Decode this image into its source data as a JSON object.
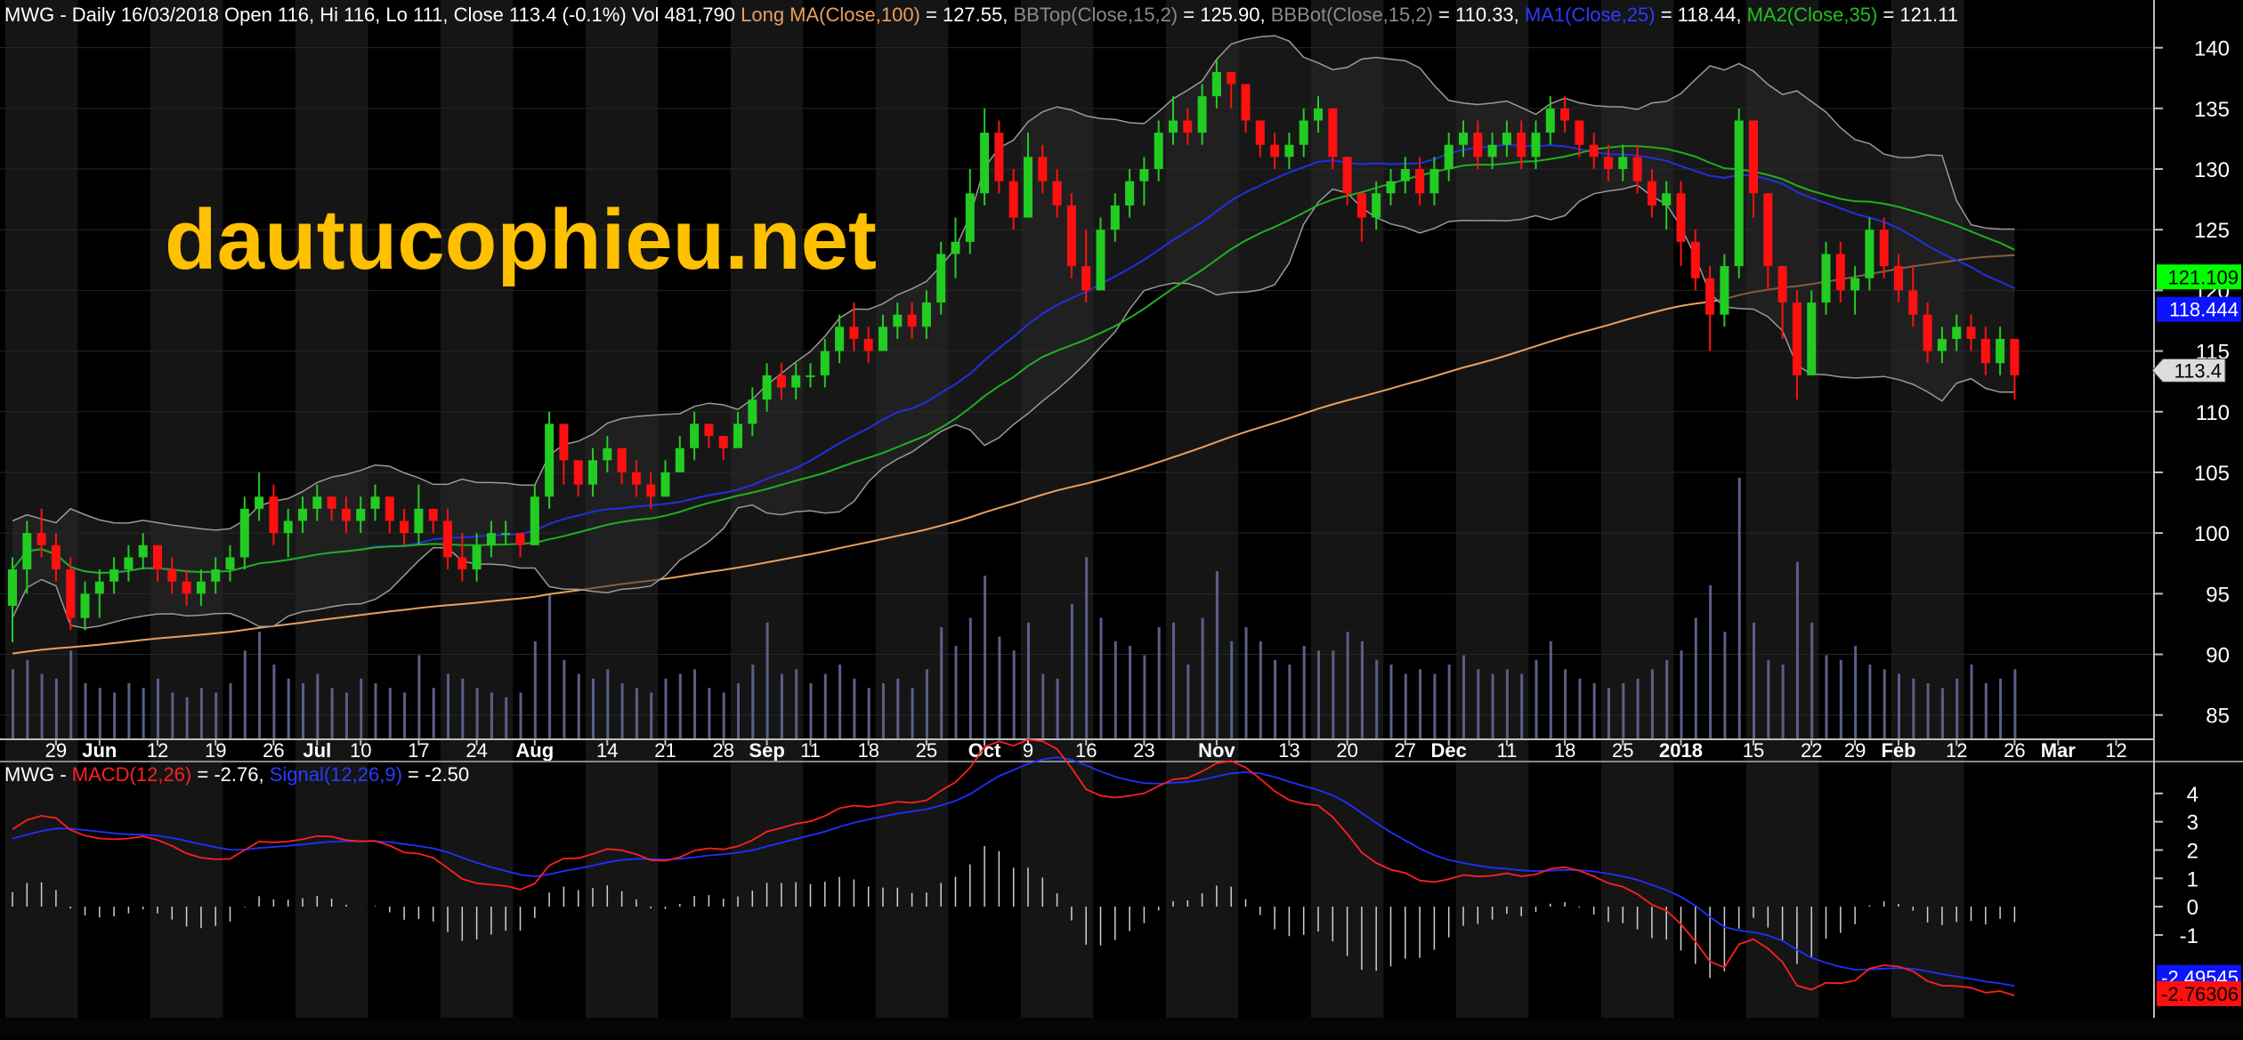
{
  "header": {
    "main_prefix": "MWG - Daily 16/03/2018 Open 116, Hi 116, Lo 111, Close 113.4 (-0.1%) Vol 481,790 ",
    "long_ma_label": "Long MA(Close,100)",
    "long_ma_value": " = 127.55, ",
    "bbtop_label": "BBTop(Close,15,2)",
    "bbtop_value": " = 125.90, ",
    "bbbot_label": "BBBot(Close,15,2)",
    "bbbot_value": " = 110.33, ",
    "ma1_label": "MA1(Close,25)",
    "ma1_value": " = 118.44, ",
    "ma2_label": "MA2(Close,35)",
    "ma2_value": " = 121.11",
    "macd_prefix": "MWG - ",
    "macd_label": "MACD(12,26)",
    "macd_value": " = -2.76, ",
    "signal_label": "Signal(12,26,9)",
    "signal_value": " = -2.50"
  },
  "watermark": "dautucophieu.net",
  "colors": {
    "up": "#22cc22",
    "down": "#ff1010",
    "ma100": "#e8a060",
    "bb": "#9a9a9a",
    "ma1": "#2030e0",
    "ma2": "#20b020",
    "macd": "#ff2020",
    "signal": "#2030ff",
    "watermark": "#ffc000"
  },
  "chart_data": [
    {
      "type": "candlestick",
      "name": "price",
      "ylim": [
        83,
        141
      ],
      "yticks": [
        85,
        90,
        95,
        100,
        105,
        110,
        115,
        120,
        125,
        130,
        135,
        140
      ],
      "xlabels": [
        {
          "i": 3,
          "t": "29"
        },
        {
          "i": 6,
          "t": "Jun"
        },
        {
          "i": 10,
          "t": "12"
        },
        {
          "i": 14,
          "t": "19"
        },
        {
          "i": 18,
          "t": "26"
        },
        {
          "i": 21,
          "t": "Jul"
        },
        {
          "i": 24,
          "t": "10"
        },
        {
          "i": 28,
          "t": "17"
        },
        {
          "i": 32,
          "t": "24"
        },
        {
          "i": 36,
          "t": "Aug"
        },
        {
          "i": 41,
          "t": "14"
        },
        {
          "i": 45,
          "t": "21"
        },
        {
          "i": 49,
          "t": "28"
        },
        {
          "i": 52,
          "t": "Sep"
        },
        {
          "i": 55,
          "t": "11"
        },
        {
          "i": 59,
          "t": "18"
        },
        {
          "i": 63,
          "t": "25"
        },
        {
          "i": 67,
          "t": "Oct"
        },
        {
          "i": 70,
          "t": "9"
        },
        {
          "i": 74,
          "t": "16"
        },
        {
          "i": 78,
          "t": "23"
        },
        {
          "i": 83,
          "t": "Nov"
        },
        {
          "i": 88,
          "t": "13"
        },
        {
          "i": 92,
          "t": "20"
        },
        {
          "i": 96,
          "t": "27"
        },
        {
          "i": 99,
          "t": "Dec"
        },
        {
          "i": 103,
          "t": "11"
        },
        {
          "i": 107,
          "t": "18"
        },
        {
          "i": 111,
          "t": "25"
        },
        {
          "i": 115,
          "t": "2018"
        },
        {
          "i": 120,
          "t": "15"
        },
        {
          "i": 124,
          "t": "22"
        },
        {
          "i": 127,
          "t": "29"
        },
        {
          "i": 130,
          "t": "Feb"
        },
        {
          "i": 134,
          "t": "12"
        },
        {
          "i": 138,
          "t": "26"
        },
        {
          "i": 141,
          "t": "Mar"
        },
        {
          "i": 145,
          "t": "12"
        }
      ],
      "ohlc": [
        [
          94,
          98,
          91,
          97
        ],
        [
          97,
          101,
          95,
          100
        ],
        [
          100,
          102,
          98,
          99
        ],
        [
          99,
          100,
          96,
          97
        ],
        [
          97,
          98,
          92,
          93
        ],
        [
          93,
          96,
          92,
          95
        ],
        [
          95,
          97,
          93,
          96
        ],
        [
          96,
          98,
          95,
          97
        ],
        [
          97,
          99,
          96,
          98
        ],
        [
          98,
          100,
          97,
          99
        ],
        [
          99,
          99,
          96,
          97
        ],
        [
          97,
          98,
          95,
          96
        ],
        [
          96,
          97,
          94,
          95
        ],
        [
          95,
          97,
          94,
          96
        ],
        [
          96,
          98,
          95,
          97
        ],
        [
          97,
          99,
          96,
          98
        ],
        [
          98,
          103,
          97,
          102
        ],
        [
          102,
          105,
          101,
          103
        ],
        [
          103,
          104,
          99,
          100
        ],
        [
          100,
          102,
          98,
          101
        ],
        [
          101,
          103,
          100,
          102
        ],
        [
          102,
          104,
          101,
          103
        ],
        [
          103,
          103,
          101,
          102
        ],
        [
          102,
          103,
          100,
          101
        ],
        [
          101,
          103,
          100,
          102
        ],
        [
          102,
          104,
          101,
          103
        ],
        [
          103,
          103,
          100,
          101
        ],
        [
          101,
          102,
          99,
          100
        ],
        [
          100,
          104,
          99,
          102
        ],
        [
          102,
          102,
          100,
          101
        ],
        [
          101,
          102,
          97,
          98
        ],
        [
          98,
          100,
          96,
          97
        ],
        [
          97,
          100,
          96,
          99
        ],
        [
          99,
          101,
          98,
          100
        ],
        [
          100,
          101,
          99,
          100
        ],
        [
          100,
          100,
          98,
          99
        ],
        [
          99,
          104,
          99,
          103
        ],
        [
          103,
          110,
          102,
          109
        ],
        [
          109,
          109,
          104,
          106
        ],
        [
          106,
          106,
          103,
          104
        ],
        [
          104,
          107,
          103,
          106
        ],
        [
          106,
          108,
          105,
          107
        ],
        [
          107,
          107,
          104,
          105
        ],
        [
          105,
          106,
          103,
          104
        ],
        [
          104,
          105,
          102,
          103
        ],
        [
          103,
          106,
          103,
          105
        ],
        [
          105,
          108,
          105,
          107
        ],
        [
          107,
          110,
          106,
          109
        ],
        [
          109,
          109,
          107,
          108
        ],
        [
          108,
          108,
          106,
          107
        ],
        [
          107,
          110,
          107,
          109
        ],
        [
          109,
          112,
          108,
          111
        ],
        [
          111,
          114,
          110,
          113
        ],
        [
          113,
          114,
          111,
          112
        ],
        [
          112,
          114,
          111,
          113
        ],
        [
          113,
          114,
          112,
          113
        ],
        [
          113,
          116,
          112,
          115
        ],
        [
          115,
          118,
          114,
          117
        ],
        [
          117,
          119,
          115,
          116
        ],
        [
          116,
          117,
          114,
          115
        ],
        [
          115,
          118,
          115,
          117
        ],
        [
          117,
          119,
          116,
          118
        ],
        [
          118,
          119,
          116,
          117
        ],
        [
          117,
          120,
          116,
          119
        ],
        [
          119,
          124,
          118,
          123
        ],
        [
          123,
          126,
          121,
          124
        ],
        [
          124,
          130,
          123,
          128
        ],
        [
          128,
          135,
          127,
          133
        ],
        [
          133,
          134,
          128,
          129
        ],
        [
          129,
          130,
          125,
          126
        ],
        [
          126,
          133,
          126,
          131
        ],
        [
          131,
          132,
          128,
          129
        ],
        [
          129,
          130,
          126,
          127
        ],
        [
          127,
          128,
          121,
          122
        ],
        [
          122,
          125,
          119,
          120
        ],
        [
          120,
          126,
          120,
          125
        ],
        [
          125,
          128,
          124,
          127
        ],
        [
          127,
          130,
          126,
          129
        ],
        [
          129,
          131,
          127,
          130
        ],
        [
          130,
          134,
          129,
          133
        ],
        [
          133,
          136,
          132,
          134
        ],
        [
          134,
          135,
          132,
          133
        ],
        [
          133,
          137,
          132,
          136
        ],
        [
          136,
          139,
          135,
          138
        ],
        [
          138,
          138,
          135,
          137
        ],
        [
          137,
          137,
          133,
          134
        ],
        [
          134,
          134,
          131,
          132
        ],
        [
          132,
          133,
          130,
          131
        ],
        [
          131,
          133,
          130,
          132
        ],
        [
          132,
          135,
          131,
          134
        ],
        [
          134,
          136,
          133,
          135
        ],
        [
          135,
          135,
          130,
          131
        ],
        [
          131,
          131,
          127,
          128
        ],
        [
          128,
          128,
          124,
          126
        ],
        [
          126,
          129,
          125,
          128
        ],
        [
          128,
          130,
          127,
          129
        ],
        [
          129,
          131,
          128,
          130
        ],
        [
          130,
          131,
          127,
          128
        ],
        [
          128,
          131,
          127,
          130
        ],
        [
          130,
          133,
          129,
          132
        ],
        [
          132,
          134,
          131,
          133
        ],
        [
          133,
          134,
          130,
          131
        ],
        [
          131,
          133,
          130,
          132
        ],
        [
          132,
          134,
          131,
          133
        ],
        [
          133,
          134,
          130,
          131
        ],
        [
          131,
          134,
          130,
          133
        ],
        [
          133,
          136,
          132,
          135
        ],
        [
          135,
          136,
          133,
          134
        ],
        [
          134,
          134,
          131,
          132
        ],
        [
          132,
          133,
          130,
          131
        ],
        [
          131,
          132,
          129,
          130
        ],
        [
          130,
          132,
          129,
          131
        ],
        [
          131,
          132,
          128,
          129
        ],
        [
          129,
          130,
          126,
          127
        ],
        [
          127,
          129,
          125,
          128
        ],
        [
          128,
          129,
          122,
          124
        ],
        [
          124,
          125,
          120,
          121
        ],
        [
          121,
          122,
          115,
          118
        ],
        [
          118,
          123,
          117,
          122
        ],
        [
          122,
          135,
          121,
          134
        ],
        [
          134,
          134,
          126,
          128
        ],
        [
          128,
          128,
          120,
          122
        ],
        [
          122,
          122,
          116,
          119
        ],
        [
          119,
          120,
          111,
          113
        ],
        [
          113,
          120,
          113,
          119
        ],
        [
          119,
          124,
          118,
          123
        ],
        [
          123,
          124,
          119,
          120
        ],
        [
          120,
          122,
          118,
          121
        ],
        [
          121,
          126,
          120,
          125
        ],
        [
          125,
          126,
          121,
          122
        ],
        [
          122,
          123,
          119,
          120
        ],
        [
          120,
          122,
          117,
          118
        ],
        [
          118,
          119,
          114,
          115
        ],
        [
          115,
          117,
          114,
          116
        ],
        [
          116,
          118,
          115,
          117
        ],
        [
          117,
          118,
          115,
          116
        ],
        [
          116,
          117,
          113,
          114
        ],
        [
          114,
          117,
          113,
          116
        ],
        [
          116,
          116,
          111,
          113
        ]
      ],
      "volume": [
        1500,
        1700,
        1400,
        1300,
        1900,
        1200,
        1100,
        1000,
        1200,
        1100,
        1300,
        1000,
        900,
        1100,
        1000,
        1200,
        1900,
        2300,
        1600,
        1300,
        1200,
        1400,
        1100,
        1000,
        1300,
        1200,
        1100,
        1000,
        1800,
        1100,
        1400,
        1300,
        1100,
        1000,
        900,
        1000,
        2100,
        3100,
        1700,
        1400,
        1300,
        1500,
        1200,
        1100,
        1000,
        1300,
        1400,
        1500,
        1100,
        1000,
        1200,
        1600,
        2500,
        1400,
        1500,
        1200,
        1400,
        1600,
        1300,
        1100,
        1200,
        1300,
        1100,
        1500,
        2400,
        2000,
        2600,
        3500,
        2200,
        1900,
        2500,
        1400,
        1300,
        2900,
        3900,
        2600,
        2100,
        2000,
        1800,
        2400,
        2500,
        1600,
        2600,
        3600,
        2100,
        2400,
        2100,
        1700,
        1600,
        2000,
        1900,
        1900,
        2300,
        2100,
        1700,
        1600,
        1400,
        1500,
        1400,
        1600,
        1800,
        1500,
        1400,
        1500,
        1400,
        1700,
        2100,
        1500,
        1300,
        1200,
        1100,
        1200,
        1300,
        1500,
        1700,
        1900,
        2600,
        3300,
        2300,
        5600,
        2500,
        1700,
        1600,
        3800,
        2500,
        1800,
        1700,
        2000,
        1600,
        1500,
        1400,
        1300,
        1200,
        1100,
        1300,
        1600,
        1200,
        1300,
        1500
      ],
      "vol_max": 8000
    },
    {
      "type": "line",
      "name": "macd",
      "ylim": [
        -3.8,
        5
      ],
      "yticks": [
        -1,
        0,
        1,
        2,
        3,
        4
      ],
      "labels": {
        "signal": "-2.49545",
        "macd": "-2.76306"
      }
    }
  ],
  "price_labels": {
    "ma2": "121.109",
    "ma1": "118.444",
    "close": "113.4"
  }
}
